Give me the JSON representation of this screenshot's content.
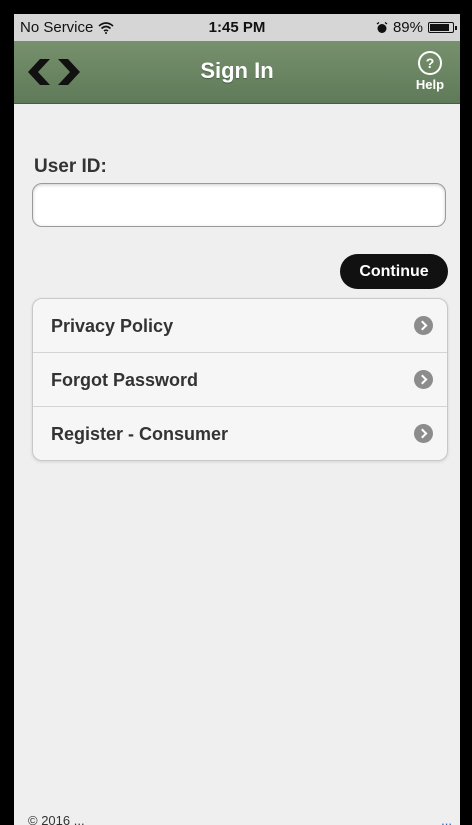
{
  "statusbar": {
    "carrier": "No Service",
    "time": "1:45 PM",
    "battery": "89%",
    "battery_level": 0.89
  },
  "nav": {
    "title": "Sign In",
    "help_label": "Help",
    "help_symbol": "?"
  },
  "form": {
    "userid_label": "User ID:",
    "userid_value": "",
    "userid_placeholder": "",
    "continue_label": "Continue"
  },
  "menu": {
    "items": [
      {
        "label": "Privacy Policy"
      },
      {
        "label": "Forgot Password"
      },
      {
        "label": "Register - Consumer"
      }
    ]
  },
  "footer": {
    "left_text": "© 2016 ...",
    "right_text": "..."
  },
  "colors": {
    "header": "#6c8763",
    "page_background": "#efefef",
    "continue_button": "#111111",
    "chevron": "#8c8c8c"
  }
}
